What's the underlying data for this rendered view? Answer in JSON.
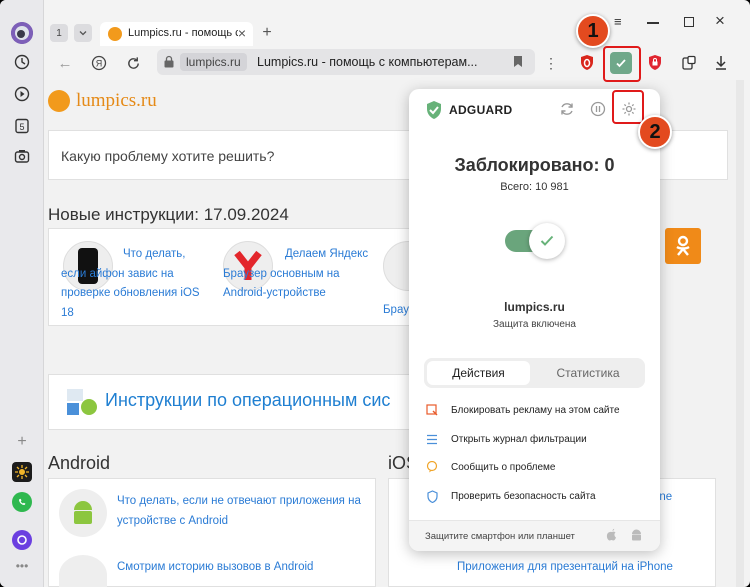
{
  "browser": {
    "tab_count": "1",
    "tab_title": "Lumpics.ru - помощь с",
    "address_domain": "lumpics.ru",
    "address_title": "Lumpics.ru - помощь с компьютерам..."
  },
  "site": {
    "logo_text": "lumpics.ru",
    "search_placeholder": "Какую проблему хотите решить?",
    "new_heading": "Новые инструкции: 17.09.2024",
    "new_items": [
      {
        "title": "Что делать, если айфон завис на проверке обновления iOS 18"
      },
      {
        "title": "Делаем Яндекс Браузер основным на Android-устройстве"
      },
      {
        "title": "Брау"
      }
    ],
    "os_heading": "Инструкции по операционным сис",
    "android_heading": "Android",
    "ios_heading": "iOS",
    "android_items": [
      {
        "title": "Что делать, если не отвечают приложения на устройстве с Android"
      },
      {
        "title": "Смотрим историю вызовов в Android"
      }
    ],
    "ios_items": [
      {
        "title": "one"
      },
      {
        "title": "Приложения для презентаций на iPhone"
      }
    ]
  },
  "adguard": {
    "brand": "ADGUARD",
    "blocked_label": "Заблокировано: 0",
    "total_label": "Всего: 10 981",
    "site": "lumpics.ru",
    "protection_status": "Защита включена",
    "tabs": [
      "Действия",
      "Статистика"
    ],
    "actions": [
      "Блокировать рекламу на этом сайте",
      "Открыть журнал фильтрации",
      "Сообщить о проблеме",
      "Проверить безопасность сайта"
    ],
    "footer_text": "Защитите смартфон или планшет",
    "accent_color": "#67b279"
  },
  "annotations": {
    "marker1": "1",
    "marker2": "2"
  }
}
